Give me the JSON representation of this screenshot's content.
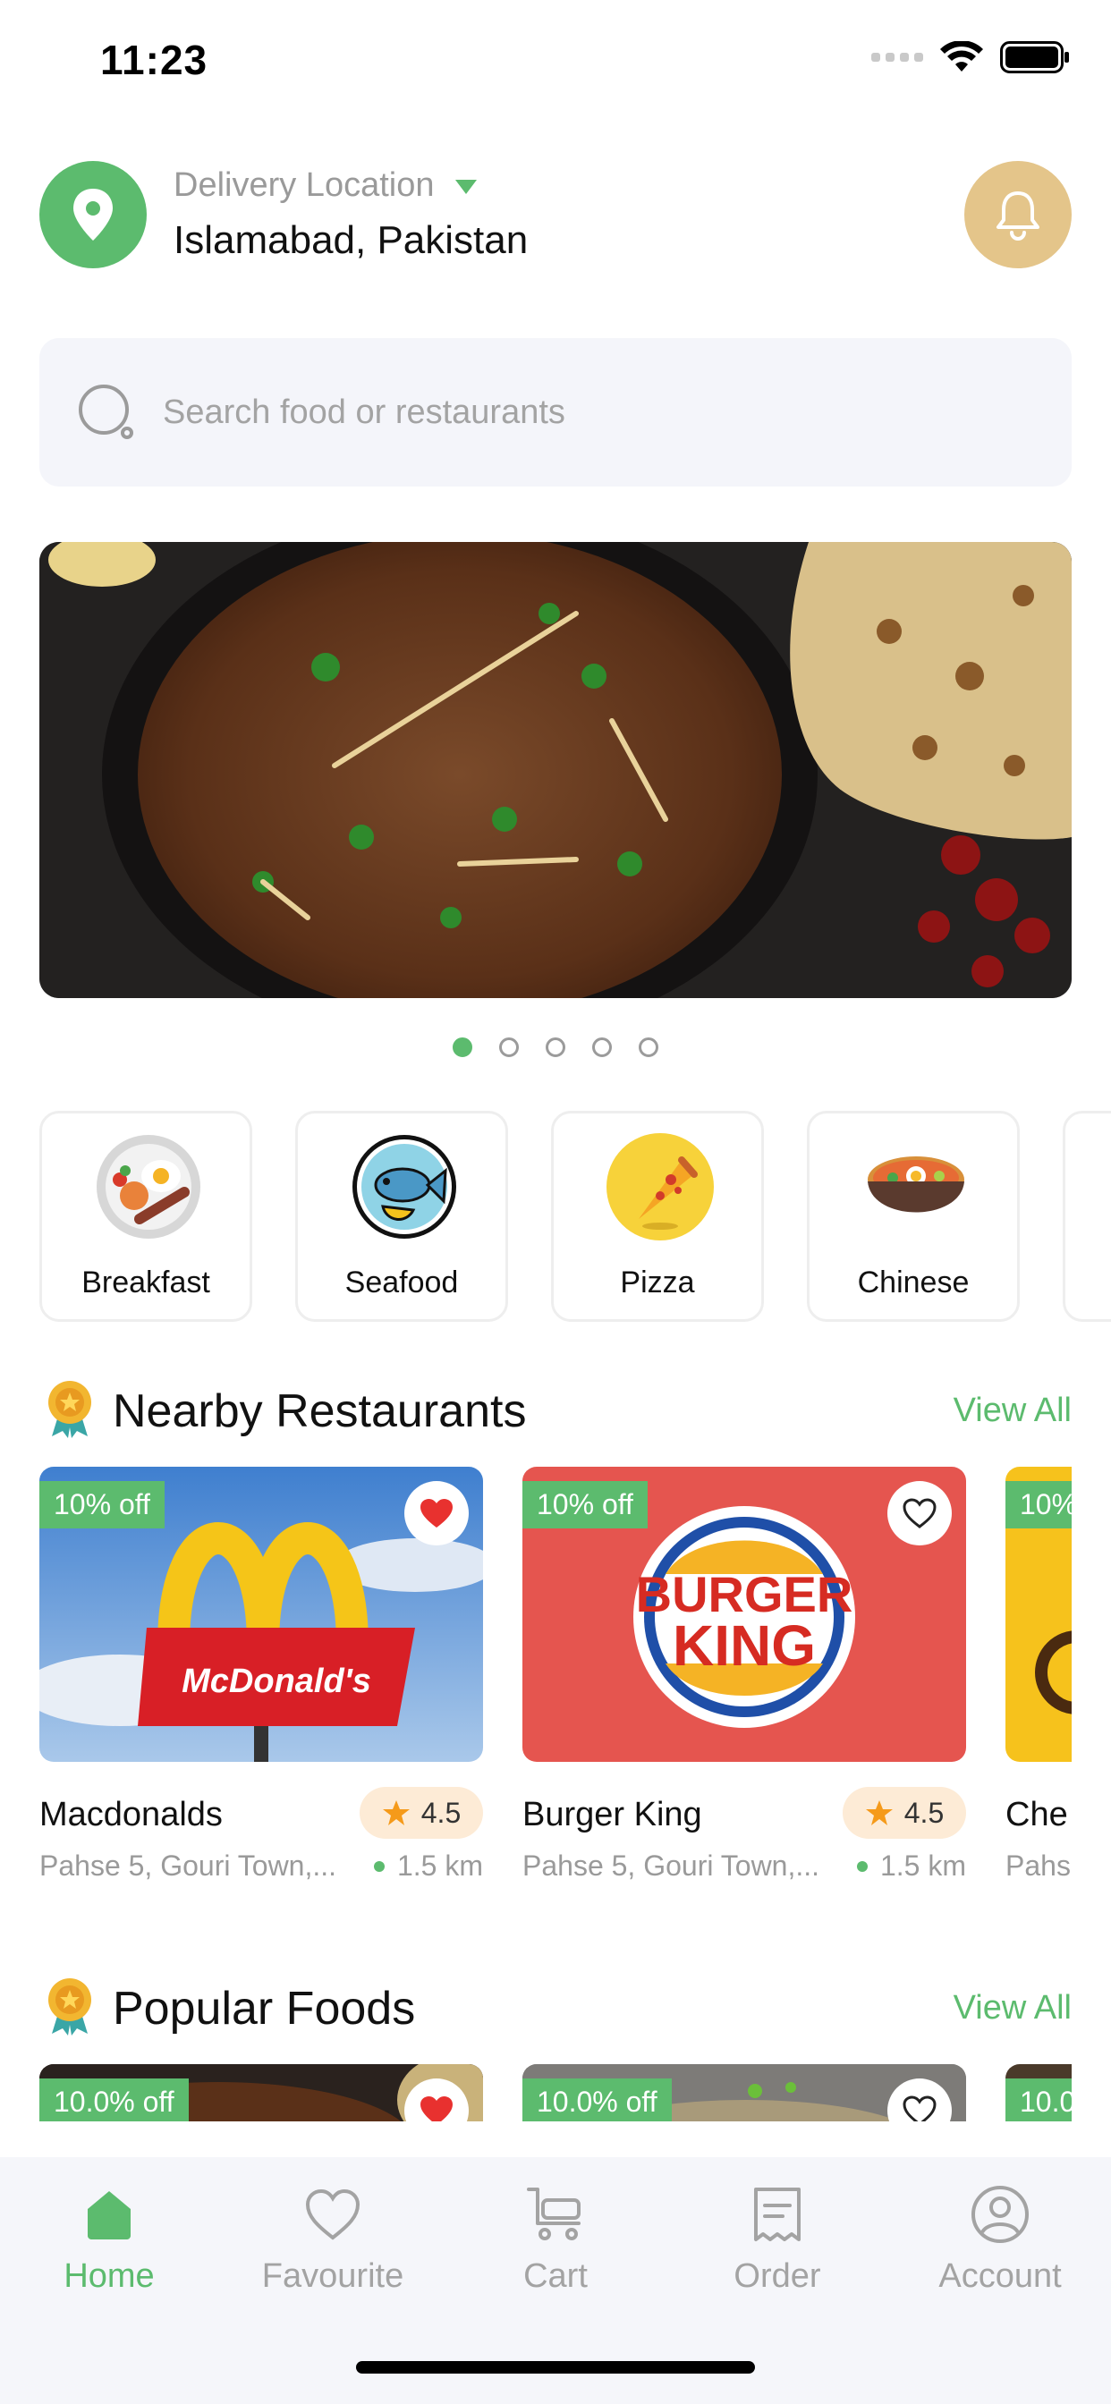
{
  "status_bar": {
    "time": "11:23"
  },
  "header": {
    "location_label": "Delivery Location",
    "location_value": "Islamabad, Pakistan"
  },
  "search": {
    "placeholder": "Search food or restaurants"
  },
  "banner": {
    "active_index": 0,
    "total": 5
  },
  "categories": [
    {
      "label": "Breakfast",
      "icon": "breakfast-plate-icon"
    },
    {
      "label": "Seafood",
      "icon": "fish-icon"
    },
    {
      "label": "Pizza",
      "icon": "pizza-slice-icon"
    },
    {
      "label": "Chinese",
      "icon": "noodle-bowl-icon"
    }
  ],
  "nearby": {
    "title": "Nearby Restaurants",
    "view_all": "View All",
    "items": [
      {
        "discount": "10% off",
        "name": "Macdonalds",
        "rating": "4.5",
        "address": "Pahse 5, Gouri Town,...",
        "distance": "1.5 km",
        "favorited": true
      },
      {
        "discount": "10% off",
        "name": "Burger King",
        "rating": "4.5",
        "address": "Pahse 5, Gouri Town,...",
        "distance": "1.5 km",
        "favorited": false
      },
      {
        "discount": "10%",
        "name": "Che",
        "address": "Pahs"
      }
    ]
  },
  "popular": {
    "title": "Popular Foods",
    "view_all": "View All",
    "items": [
      {
        "discount": "10.0% off",
        "favorited": true
      },
      {
        "discount": "10.0% off",
        "favorited": false
      },
      {
        "discount": "10.0"
      }
    ]
  },
  "tabs": [
    {
      "label": "Home",
      "active": true
    },
    {
      "label": "Favourite"
    },
    {
      "label": "Cart"
    },
    {
      "label": "Order"
    },
    {
      "label": "Account"
    }
  ],
  "colors": {
    "accent": "#5cbb6e",
    "bell_bg": "#e4c58a",
    "rating_bg": "#fdebd6",
    "favorite": "#e8312f"
  }
}
